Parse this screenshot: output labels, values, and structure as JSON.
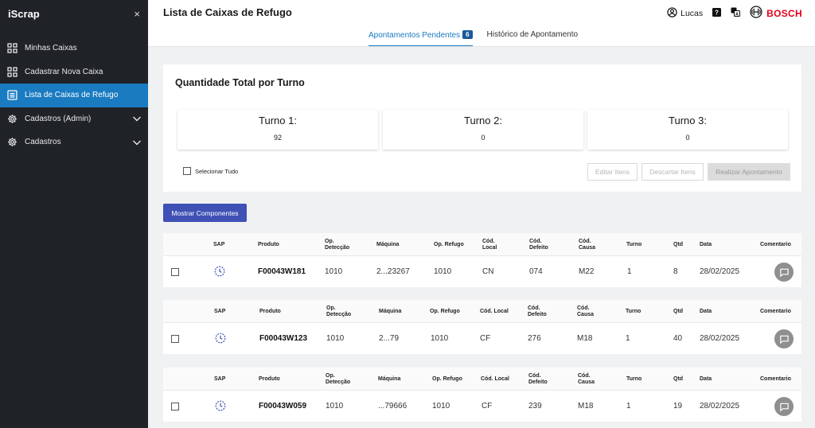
{
  "app": {
    "name": "iScrap",
    "close_glyph": "×"
  },
  "sidebar": {
    "items": [
      {
        "label": "Minhas Caixas",
        "icon": "grid-icon",
        "active": false,
        "expandable": false
      },
      {
        "label": "Cadastrar Nova Caixa",
        "icon": "grid-icon",
        "active": false,
        "expandable": false
      },
      {
        "label": "Lista de Caixas de Refugo",
        "icon": "list-icon",
        "active": true,
        "expandable": false
      },
      {
        "label": "Cadastros (Admin)",
        "icon": "gear-icon",
        "active": false,
        "expandable": true
      },
      {
        "label": "Cadastros",
        "icon": "gear-icon",
        "active": false,
        "expandable": true
      }
    ]
  },
  "header": {
    "title": "Lista de Caixas de Refugo",
    "user": "Lucas",
    "brand": "BOSCH",
    "tabs": [
      {
        "label": "Apontamentos Pendentes",
        "badge": "6",
        "active": true
      },
      {
        "label": "Histórico de Apontamento",
        "active": false
      }
    ]
  },
  "summary": {
    "title": "Quantidade Total por Turno",
    "turnos": [
      {
        "label": "Turno 1:",
        "value": "92"
      },
      {
        "label": "Turno 2:",
        "value": "0"
      },
      {
        "label": "Turno 3:",
        "value": "0"
      }
    ],
    "select_all": "Selecionar Tudo",
    "edit_button": "Editar Itens",
    "discard_button": "Descartar Itens",
    "submit_button": "Realizar Apontamento"
  },
  "show_components_button": "Mostrar Componentes",
  "rows": [
    {
      "headers": {
        "sap": "SAP",
        "produto": "Produto",
        "op_det_1": "Op.",
        "op_det_2": "Detecção",
        "maquina": "Máquina",
        "op_refugo": "Op. Refugo",
        "cod_local_1": "Cód.",
        "cod_local_2": "Local",
        "cod_defeito_1": "Cód.",
        "cod_defeito_2": "Defeito",
        "cod_causa_1": "Cód.",
        "cod_causa_2": "Causa",
        "turno": "Turno",
        "qtd": "Qtd",
        "data": "Data",
        "comentario": "Comentario"
      },
      "produto": "F00043W181",
      "op_deteccao": "1010",
      "maquina": "2...23267",
      "op_refugo": "1010",
      "cod_local": "CN",
      "cod_defeito": "074",
      "cod_causa": "M22",
      "turno": "1",
      "qtd": "8",
      "data": "28/02/2025"
    },
    {
      "headers": {
        "sap": "SAP",
        "produto": "Produto",
        "op_det_1": "Op.",
        "op_det_2": "Detecção",
        "maquina": "Máquina",
        "op_refugo": "Op. Refugo",
        "cod_local": "Cód. Local",
        "cod_defeito_1": "Cód.",
        "cod_defeito_2": "Defeito",
        "cod_causa_1": "Cód.",
        "cod_causa_2": "Causa",
        "turno": "Turno",
        "qtd": "Qtd",
        "data": "Data",
        "comentario": "Comentario"
      },
      "produto": "F00043W123",
      "op_deteccao": "1010",
      "maquina": "2...79",
      "op_refugo": "1010",
      "cod_local": "CF",
      "cod_defeito": "276",
      "cod_causa": "M18",
      "turno": "1",
      "qtd": "40",
      "data": "28/02/2025"
    },
    {
      "headers": {
        "sap": "SAP",
        "produto": "Produto",
        "op_det_1": "Op.",
        "op_det_2": "Detecção",
        "maquina": "Máquina",
        "op_refugo": "Op. Refugo",
        "cod_local": "Cód. Local",
        "cod_defeito_1": "Cód.",
        "cod_defeito_2": "Defeito",
        "cod_causa_1": "Cód.",
        "cod_causa_2": "Causa",
        "turno": "Turno",
        "qtd": "Qtd",
        "data": "Data",
        "comentario": "Comentario"
      },
      "produto": "F00043W059",
      "op_deteccao": "1010",
      "maquina": "...79666",
      "op_refugo": "1010",
      "cod_local": "CF",
      "cod_defeito": "239",
      "cod_causa": "M18",
      "turno": "1",
      "qtd": "19",
      "data": "28/02/2025"
    }
  ],
  "colors": {
    "sidebar_bg": "#1f2226",
    "accent": "#1a7bc1",
    "primary_button": "#3f51b5",
    "brand_red": "#e2001a"
  }
}
